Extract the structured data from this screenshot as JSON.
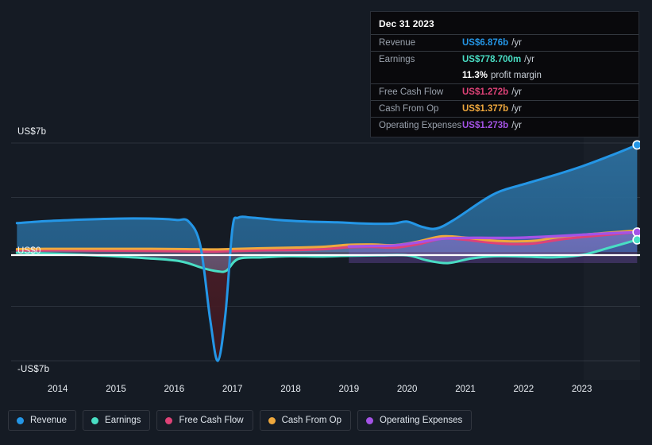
{
  "chart_data": {
    "type": "area",
    "title": "",
    "xlabel": "",
    "ylabel": "",
    "xlim": [
      2013.2,
      2024.0
    ],
    "ylim": [
      -7,
      7
    ],
    "y_ticks": [
      "US$7b",
      "US$0",
      "-US$7b"
    ],
    "y_tick_values": [
      7,
      0,
      -7
    ],
    "gridlines": [
      7,
      3.5,
      0,
      -3.5,
      -7
    ],
    "x_ticks": [
      "2014",
      "2015",
      "2016",
      "2017",
      "2018",
      "2019",
      "2020",
      "2021",
      "2022",
      "2023"
    ],
    "x_tick_values": [
      2014,
      2015,
      2016,
      2017,
      2018,
      2019,
      2020,
      2021,
      2022,
      2023
    ],
    "legend_position": "bottom",
    "grid": true,
    "units": "US$ billions per year",
    "series": [
      {
        "name": "Revenue",
        "color": "#2496e6",
        "x": [
          2013.3,
          2013.8,
          2014.3,
          2014.8,
          2015.3,
          2015.8,
          2016.05,
          2016.25,
          2016.45,
          2016.62,
          2016.75,
          2016.88,
          2017.0,
          2017.1,
          2017.35,
          2017.8,
          2018.3,
          2018.8,
          2019.3,
          2019.75,
          2020.0,
          2020.25,
          2020.5,
          2020.8,
          2021.3,
          2021.6,
          2022.0,
          2022.5,
          2023.0,
          2023.5,
          2023.95
        ],
        "values": [
          1.85,
          1.98,
          2.06,
          2.12,
          2.15,
          2.12,
          2.05,
          1.95,
          0.4,
          -4.4,
          -7.0,
          -4.0,
          1.5,
          2.2,
          2.2,
          2.05,
          1.95,
          1.9,
          1.82,
          1.82,
          1.95,
          1.62,
          1.5,
          2.05,
          3.3,
          3.9,
          4.35,
          4.9,
          5.5,
          6.2,
          6.88
        ]
      },
      {
        "name": "Earnings",
        "color": "#49dec4",
        "x": [
          2013.3,
          2014.0,
          2014.8,
          2015.5,
          2016.1,
          2016.5,
          2016.75,
          2016.9,
          2017.1,
          2017.5,
          2018.0,
          2018.5,
          2019.0,
          2019.5,
          2020.0,
          2020.35,
          2020.7,
          2021.1,
          2021.5,
          2022.0,
          2022.5,
          2023.0,
          2023.5,
          2023.95
        ],
        "values": [
          -0.05,
          -0.12,
          -0.25,
          -0.4,
          -0.6,
          -1.05,
          -1.25,
          -1.2,
          -0.45,
          -0.35,
          -0.28,
          -0.3,
          -0.25,
          -0.22,
          -0.22,
          -0.55,
          -0.72,
          -0.42,
          -0.28,
          -0.3,
          -0.35,
          -0.2,
          0.3,
          0.78
        ]
      },
      {
        "name": "Free Cash Flow",
        "color": "#de4277",
        "x": [
          2013.3,
          2014.0,
          2014.8,
          2015.6,
          2016.2,
          2016.7,
          2017.1,
          2017.6,
          2018.1,
          2018.6,
          2019.0,
          2019.4,
          2019.8,
          2020.2,
          2020.6,
          2021.0,
          2021.4,
          2021.8,
          2022.2,
          2022.6,
          2023.0,
          2023.5,
          2023.95
        ],
        "values": [
          0.08,
          0.1,
          0.08,
          0.06,
          0.03,
          0.02,
          0.06,
          0.1,
          0.12,
          0.18,
          0.3,
          0.32,
          0.28,
          0.5,
          0.85,
          0.78,
          0.6,
          0.5,
          0.55,
          0.78,
          0.95,
          1.12,
          1.27
        ]
      },
      {
        "name": "Cash From Op",
        "color": "#efa83d",
        "x": [
          2013.3,
          2014.0,
          2014.8,
          2015.6,
          2016.2,
          2016.7,
          2017.1,
          2017.6,
          2018.1,
          2018.6,
          2019.0,
          2019.4,
          2019.8,
          2020.2,
          2020.6,
          2021.0,
          2021.4,
          2021.8,
          2022.2,
          2022.6,
          2023.0,
          2023.5,
          2023.95
        ],
        "values": [
          0.18,
          0.2,
          0.2,
          0.2,
          0.18,
          0.16,
          0.2,
          0.24,
          0.28,
          0.34,
          0.46,
          0.48,
          0.44,
          0.68,
          1.0,
          0.92,
          0.75,
          0.68,
          0.72,
          0.95,
          1.1,
          1.25,
          1.38
        ]
      },
      {
        "name": "Operating Expenses",
        "color": "#a453e6",
        "x": [
          2019.0,
          2019.4,
          2019.8,
          2020.2,
          2020.6,
          2021.0,
          2021.4,
          2021.8,
          2022.2,
          2022.6,
          2023.0,
          2023.5,
          2023.95
        ],
        "values": [
          0.35,
          0.38,
          0.42,
          0.62,
          0.85,
          0.9,
          0.9,
          0.9,
          0.95,
          1.02,
          1.1,
          1.2,
          1.27
        ]
      }
    ]
  },
  "tooltip": {
    "date": "Dec 31 2023",
    "rows": [
      {
        "label": "Revenue",
        "value": "US$6.876b",
        "unit": "/yr",
        "color": "#2496e6"
      },
      {
        "label": "Earnings",
        "value": "US$778.700m",
        "unit": "/yr",
        "color": "#49dec4"
      },
      {
        "label": "",
        "value": "11.3%",
        "unit": "profit margin",
        "color": "#ffffff"
      },
      {
        "label": "Free Cash Flow",
        "value": "US$1.272b",
        "unit": "/yr",
        "color": "#de4277"
      },
      {
        "label": "Cash From Op",
        "value": "US$1.377b",
        "unit": "/yr",
        "color": "#efa83d"
      },
      {
        "label": "Operating Expenses",
        "value": "US$1.273b",
        "unit": "/yr",
        "color": "#a453e6"
      }
    ]
  },
  "legend": {
    "items": [
      {
        "label": "Revenue",
        "color": "#2496e6"
      },
      {
        "label": "Earnings",
        "color": "#49dec4"
      },
      {
        "label": "Free Cash Flow",
        "color": "#de4277"
      },
      {
        "label": "Cash From Op",
        "color": "#efa83d"
      },
      {
        "label": "Operating Expenses",
        "color": "#a453e6"
      }
    ]
  },
  "colors": {
    "background": "#151b24",
    "zero_line": "#ffffff",
    "grid": "#2b323c",
    "tooltip_bg": "#09090c"
  }
}
